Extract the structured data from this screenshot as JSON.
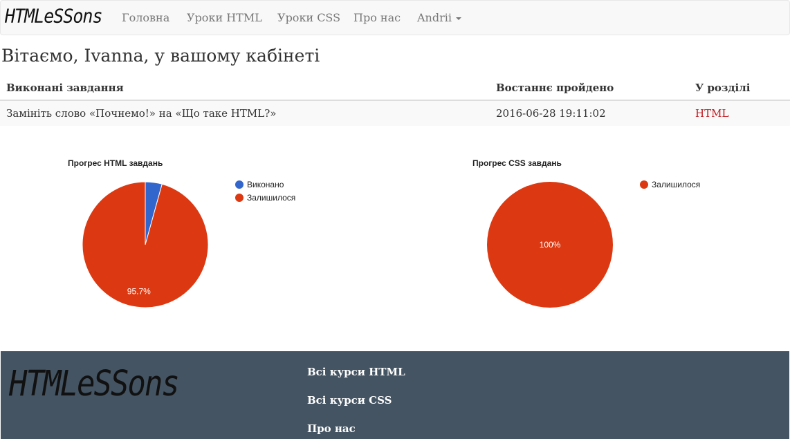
{
  "navbar": {
    "brand": "HTMLeSSons",
    "items": [
      "Головна",
      "Уроки HTML",
      "Уроки CSS",
      "Про нас"
    ],
    "user": "Andrii"
  },
  "page": {
    "greeting": "Вітаємо, Ivanna, у вашому кабінеті"
  },
  "table": {
    "headers": [
      "Виконані завдання",
      "Востаннє пройдено",
      "У розділі"
    ],
    "rows": [
      {
        "task": "Замініть слово «Почнемо!» на «Що таке HTML?»",
        "date": "2016-06-28 19:11:02",
        "section": "HTML"
      }
    ]
  },
  "colors": {
    "done": "#3366cc",
    "remaining": "#dc3912",
    "footer_bg": "#445463",
    "section_link": "#c0171e"
  },
  "chart_data": [
    {
      "type": "pie",
      "title": "Прогрес HTML завдань",
      "labels": [
        "Виконано",
        "Залишилося"
      ],
      "legend": [
        "Виконано",
        "Залишилося"
      ],
      "values": [
        4.3,
        95.7
      ],
      "slice_labels": [
        "",
        "95.7%"
      ],
      "legend_position": "right"
    },
    {
      "type": "pie",
      "title": "Прогрес CSS завдань",
      "labels": [
        "Залишилося"
      ],
      "legend": [
        "Залишилося"
      ],
      "values": [
        100
      ],
      "slice_labels": [
        "100%"
      ],
      "legend_position": "right"
    }
  ],
  "footer": {
    "logo": "HTMLeSSons",
    "links": [
      "Всі курси HTML",
      "Всі курси CSS",
      "Про нас"
    ]
  }
}
